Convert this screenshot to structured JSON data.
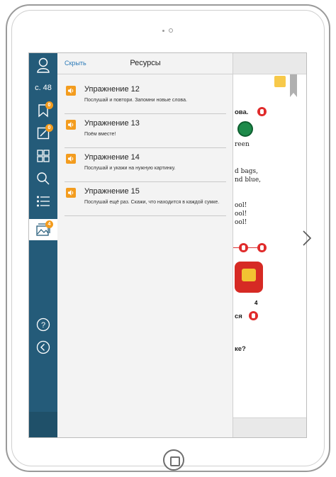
{
  "sidebar": {
    "page_label": "с. 48",
    "bookmarks_badge": "0",
    "notes_badge": "0",
    "resources_badge": "4"
  },
  "panel": {
    "hide_label": "Скрыть",
    "title": "Ресурсы",
    "items": [
      {
        "title": "Упражнение 12",
        "description": "Послушай и повтори. Запомни новые слова."
      },
      {
        "title": "Упражнение 13",
        "description": "Поём вместе!"
      },
      {
        "title": "Упражнение 14",
        "description": "Послушай и укажи на нужную картинку."
      },
      {
        "title": "Упражнение 15",
        "description": "Послушай ещё раз. Скажи, что находится в каждой сумке."
      }
    ]
  },
  "book": {
    "fragments": [
      "ова.",
      "reen",
      "d bags,",
      "nd blue,",
      "ool!",
      "ool!",
      "ool!",
      "4",
      "ся",
      "ке?"
    ]
  },
  "colors": {
    "sidebar": "#245b79",
    "accent": "#f39c1e",
    "link": "#2a7ab8"
  },
  "icons": [
    "user-icon",
    "bookmark-icon",
    "note-icon",
    "grid-icon",
    "search-icon",
    "contents-icon",
    "resources-icon",
    "help-icon",
    "back-icon",
    "speaker-icon",
    "chevron-right-icon"
  ]
}
